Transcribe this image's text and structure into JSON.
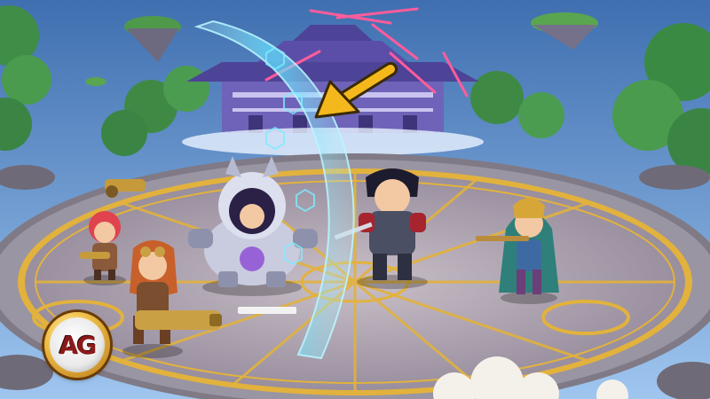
{
  "logo": {
    "text": "AG",
    "icon": "ag-logo-badge"
  },
  "colors": {
    "sky_top": "#3f6fb0",
    "sky_bottom": "#8fb9e6",
    "arena_floor": "#b8aab0",
    "arena_gold": "#e2b23d",
    "beam": "#5fe0ff",
    "arrow": "#f5b81c",
    "temple_roof": "#5b4ea8"
  },
  "scene": {
    "enemy_health_fraction": 1.0,
    "heroes": [
      {
        "name": "red-haired-gunner"
      },
      {
        "name": "steampunk-minigun-girl"
      },
      {
        "name": "armored-mech-hero"
      },
      {
        "name": "dark-knight-swordsman"
      },
      {
        "name": "hooded-crossbow-archer"
      }
    ]
  }
}
